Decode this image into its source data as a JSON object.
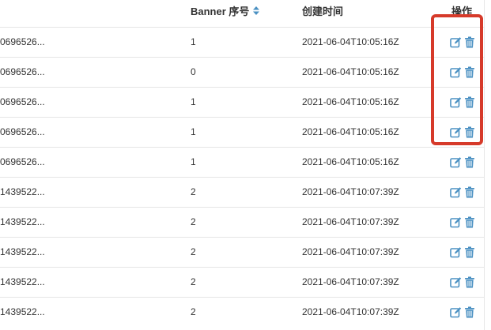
{
  "table": {
    "columns": {
      "id": "",
      "banner_no": "Banner 序号",
      "created_at": "创建时间",
      "actions": "操作"
    },
    "rows": [
      {
        "id": "0696526...",
        "banner_no": "1",
        "created_at": "2021-06-04T10:05:16Z"
      },
      {
        "id": "0696526...",
        "banner_no": "0",
        "created_at": "2021-06-04T10:05:16Z"
      },
      {
        "id": "0696526...",
        "banner_no": "1",
        "created_at": "2021-06-04T10:05:16Z"
      },
      {
        "id": "0696526...",
        "banner_no": "1",
        "created_at": "2021-06-04T10:05:16Z"
      },
      {
        "id": "0696526...",
        "banner_no": "1",
        "created_at": "2021-06-04T10:05:16Z"
      },
      {
        "id": "1439522...",
        "banner_no": "2",
        "created_at": "2021-06-04T10:07:39Z"
      },
      {
        "id": "1439522...",
        "banner_no": "2",
        "created_at": "2021-06-04T10:07:39Z"
      },
      {
        "id": "1439522...",
        "banner_no": "2",
        "created_at": "2021-06-04T10:07:39Z"
      },
      {
        "id": "1439522...",
        "banner_no": "2",
        "created_at": "2021-06-04T10:07:39Z"
      },
      {
        "id": "1439522...",
        "banner_no": "2",
        "created_at": "2021-06-04T10:07:39Z"
      }
    ],
    "row_actions": [
      "edit-icon",
      "trash-icon"
    ]
  },
  "colors": {
    "action_icon": "#4a90c2",
    "highlight_box": "#d63a2a",
    "sort_icon": "#4a90c2",
    "row_border": "#e6e6e6"
  }
}
